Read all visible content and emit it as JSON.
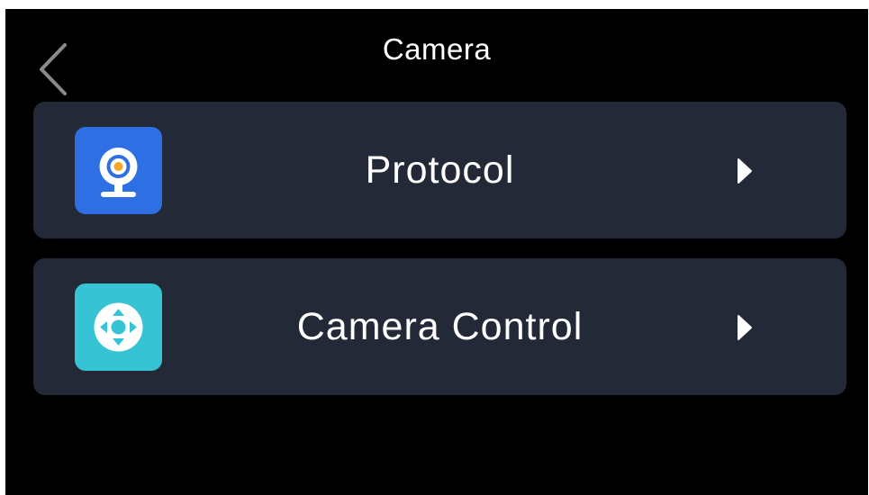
{
  "header": {
    "title": "Camera",
    "back_icon": "chevron-left-icon"
  },
  "menu": {
    "items": [
      {
        "label": "Protocol",
        "icon": "webcam-icon",
        "icon_color": "#2F6FE4",
        "arrow_icon": "caret-right-icon"
      },
      {
        "label": "Camera Control",
        "icon": "ptz-direction-icon",
        "icon_color": "#36C3D3",
        "arrow_icon": "caret-right-icon"
      }
    ]
  },
  "colors": {
    "background": "#000000",
    "card": "#232936",
    "text": "#FFFFFF",
    "back_arrow": "#8A8A8A"
  }
}
